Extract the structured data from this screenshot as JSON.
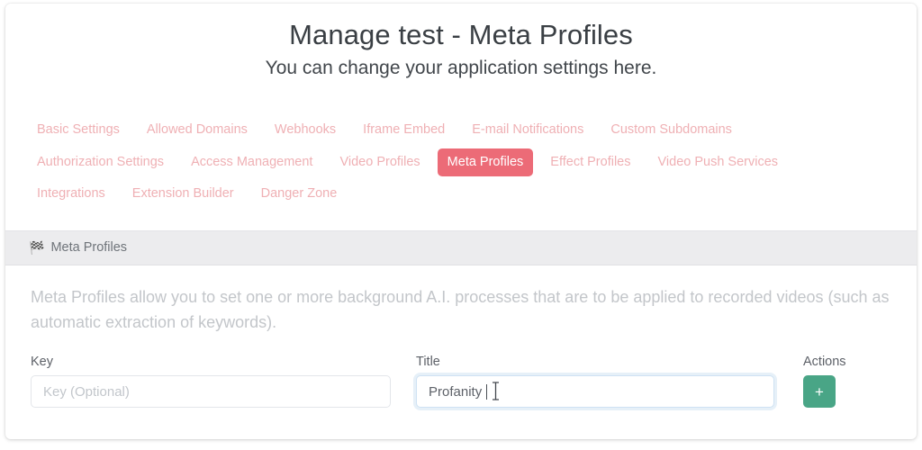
{
  "header": {
    "title": "Manage test - Meta Profiles",
    "subtitle": "You can change your application settings here."
  },
  "tabs": [
    {
      "label": "Basic Settings",
      "active": false
    },
    {
      "label": "Allowed Domains",
      "active": false
    },
    {
      "label": "Webhooks",
      "active": false
    },
    {
      "label": "Iframe Embed",
      "active": false
    },
    {
      "label": "E-mail Notifications",
      "active": false
    },
    {
      "label": "Custom Subdomains",
      "active": false
    },
    {
      "label": "Authorization Settings",
      "active": false
    },
    {
      "label": "Access Management",
      "active": false
    },
    {
      "label": "Video Profiles",
      "active": false
    },
    {
      "label": "Meta Profiles",
      "active": true
    },
    {
      "label": "Effect Profiles",
      "active": false
    },
    {
      "label": "Video Push Services",
      "active": false
    },
    {
      "label": "Integrations",
      "active": false
    },
    {
      "label": "Extension Builder",
      "active": false
    },
    {
      "label": "Danger Zone",
      "active": false
    }
  ],
  "panel": {
    "icon": "checkered-flag-icon",
    "icon_glyph": "🏁",
    "title": "Meta Profiles",
    "description": "Meta Profiles allow you to set one or more background A.I. processes that are to be applied to recorded videos (such as automatic extraction of keywords)."
  },
  "form": {
    "key": {
      "label": "Key",
      "placeholder": "Key (Optional)",
      "value": ""
    },
    "title": {
      "label": "Title",
      "placeholder": "",
      "value": "Profanity",
      "focused": true
    },
    "actions": {
      "label": "Actions",
      "add_button_glyph": "+"
    }
  },
  "colors": {
    "accent_pink": "#ec6b77",
    "tab_inactive": "#efb0b4",
    "add_green": "#49a586",
    "panel_head_bg": "#ececee",
    "description_gray": "#c3c6ca"
  }
}
